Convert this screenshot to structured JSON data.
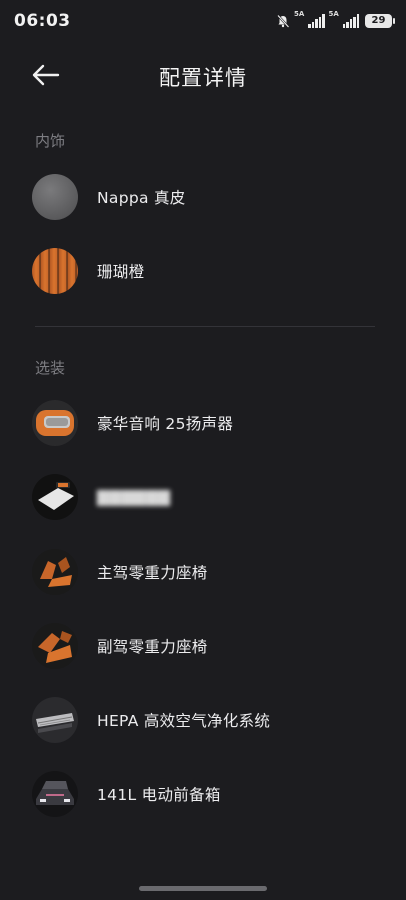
{
  "status_bar": {
    "time": "06:03",
    "sim1_label": "5A",
    "sim2_label": "5A",
    "battery": "29"
  },
  "header": {
    "title": "配置详情"
  },
  "interior": {
    "section_title": "内饰",
    "items": [
      {
        "label": "Nappa 真皮",
        "icon": "gray-leather-swatch"
      },
      {
        "label": "珊瑚橙",
        "icon": "orange-stripe-swatch"
      }
    ]
  },
  "options": {
    "section_title": "选装",
    "items": [
      {
        "label": "豪华音响 25扬声器",
        "icon": "speaker-thumb"
      },
      {
        "label": "",
        "icon": "device-thumb",
        "note": "label obscured"
      },
      {
        "label": "主驾零重力座椅",
        "icon": "driver-seat-thumb"
      },
      {
        "label": "副驾零重力座椅",
        "icon": "passenger-seat-thumb"
      },
      {
        "label": "HEPA 高效空气净化系统",
        "icon": "air-filter-thumb"
      },
      {
        "label": "141L 电动前备箱",
        "icon": "front-trunk-thumb"
      }
    ]
  },
  "colors": {
    "background": "#1c1c1f",
    "accent_orange": "#d9742e",
    "muted_text": "#7d7d82"
  }
}
